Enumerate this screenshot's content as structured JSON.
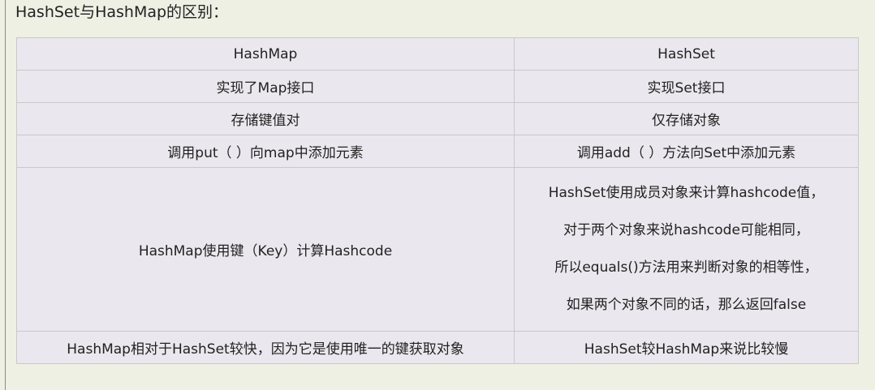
{
  "page": {
    "title": "HashSet与HashMap的区别："
  },
  "table": {
    "headers": [
      "HashMap",
      "HashSet"
    ],
    "rows": [
      {
        "hashmap": "实现了Map接口",
        "hashset": "实现Set接口"
      },
      {
        "hashmap": "存储键值对",
        "hashset": "仅存储对象"
      },
      {
        "hashmap": "调用put（ ）向map中添加元素",
        "hashset": "调用add（ ）方法向Set中添加元素"
      },
      {
        "hashmap": "HashMap使用键（Key）计算Hashcode",
        "hashset_lines": [
          "HashSet使用成员对象来计算hashcode值，",
          "对于两个对象来说hashcode可能相同，",
          "所以equals()方法用来判断对象的相等性，",
          "如果两个对象不同的话，那么返回false"
        ]
      },
      {
        "hashmap": "HashMap相对于HashSet较快，因为它是使用唯一的键获取对象",
        "hashset": "HashSet较HashMap来说比较慢"
      }
    ]
  }
}
